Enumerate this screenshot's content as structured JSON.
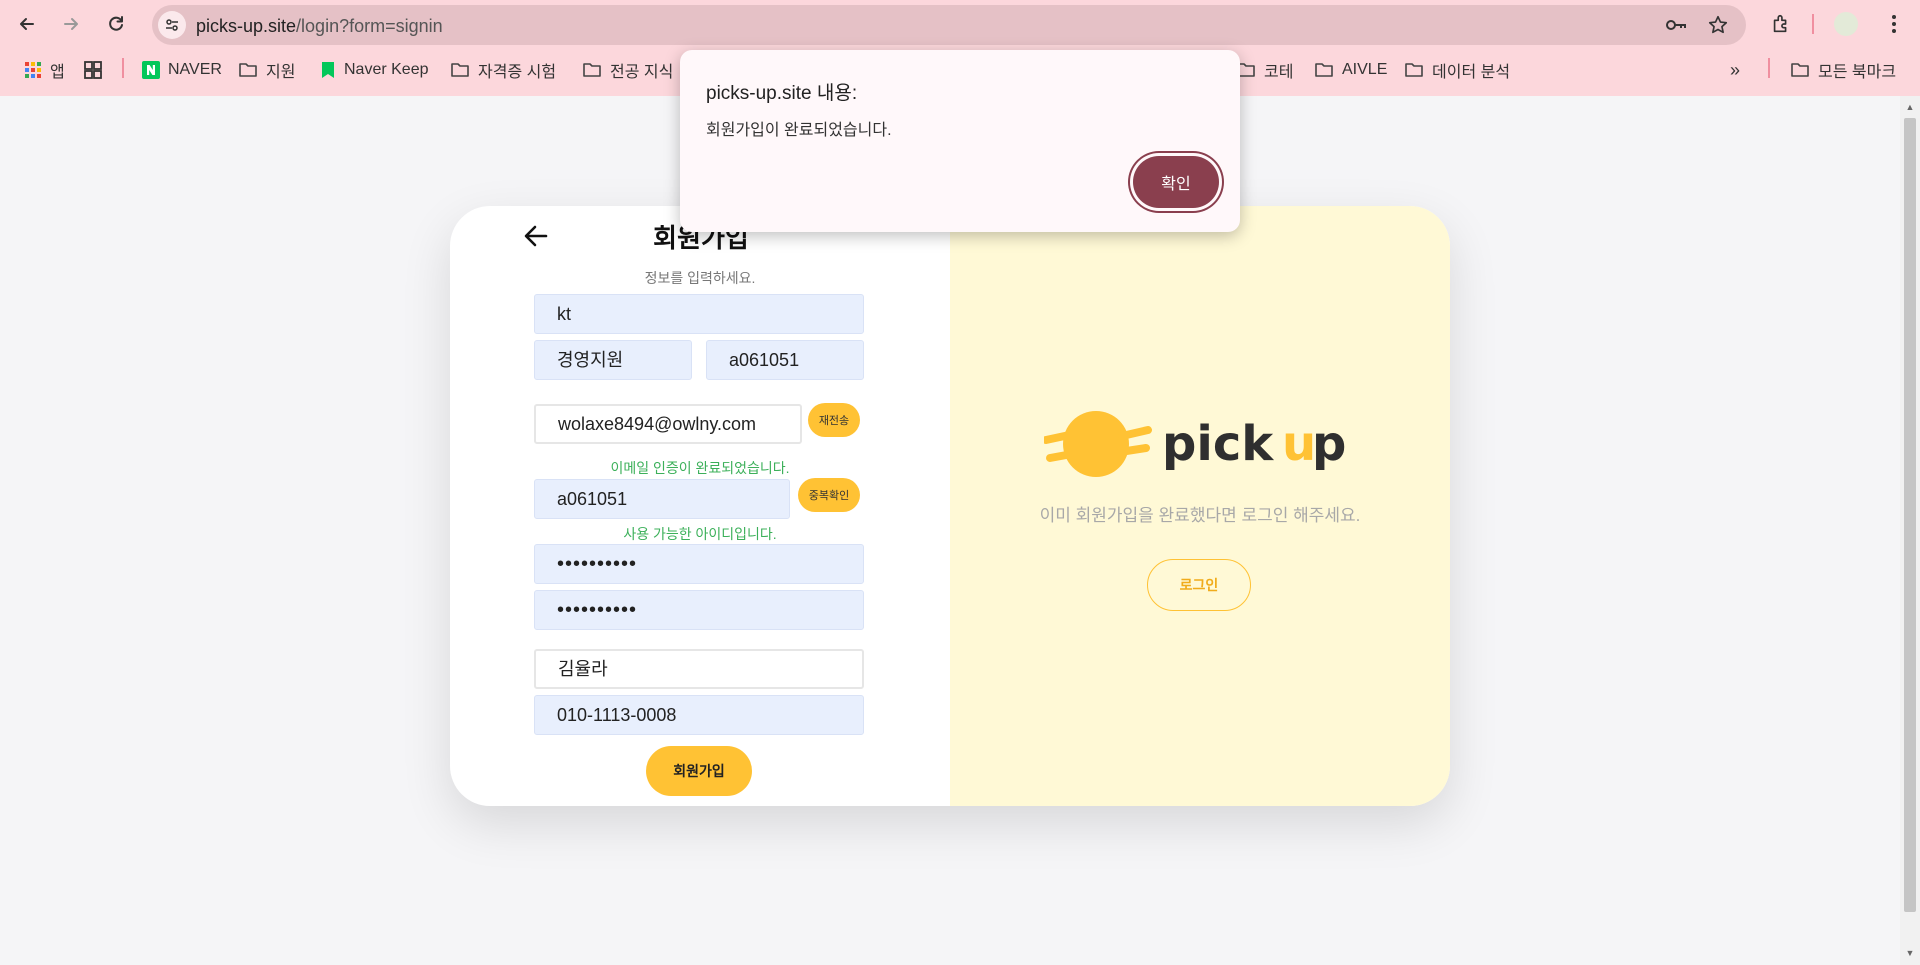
{
  "browser": {
    "url_host": "picks-up.site",
    "url_path": "/login?form=signin",
    "bookmarks": [
      {
        "label": "앱",
        "icon": "apps-grid-icon"
      },
      {
        "label": "",
        "icon": "tab-groups-icon"
      },
      {
        "label": "NAVER",
        "icon": "naver-icon"
      },
      {
        "label": "지원",
        "icon": "folder-icon"
      },
      {
        "label": "Naver Keep",
        "icon": "keep-bookmark-icon"
      },
      {
        "label": "자격증 시험",
        "icon": "folder-icon"
      },
      {
        "label": "전공 지식",
        "icon": "folder-icon"
      },
      {
        "label": "코테",
        "icon": "folder-icon"
      },
      {
        "label": "AIVLE",
        "icon": "folder-icon"
      },
      {
        "label": "데이터 분석",
        "icon": "folder-icon"
      },
      {
        "label": "모든 북마크",
        "icon": "folder-icon"
      }
    ],
    "overflow_label": "»"
  },
  "signup": {
    "title": "회원가입",
    "subtitle": "정보를 입력하세요.",
    "company": "kt",
    "department": "경영지원",
    "employee_id": "a061051",
    "email": "wolaxe8494@owlny.com",
    "resend_label": "재전송",
    "email_verified_msg": "이메일 인증이 완료되었습니다.",
    "user_id": "a061051",
    "dup_check_label": "중복확인",
    "id_available_msg": "사용 가능한 아이디입니다.",
    "password": "••••••••••",
    "password_confirm": "••••••••••",
    "name": "김율라",
    "phone": "010-1113-0008",
    "submit_label": "회원가입"
  },
  "promo": {
    "brand_word1": "pick",
    "brand_word2_u": "u",
    "brand_word2_p": "p",
    "hint": "이미 회원가입을 완료했다면 로그인 해주세요.",
    "login_label": "로그인",
    "accent_color": "#ffc234",
    "panel_color": "#fff9d6"
  },
  "alert": {
    "title": "picks-up.site 내용:",
    "message": "회원가입이 완료되었습니다.",
    "ok_label": "확인",
    "button_color": "#8a3f4e"
  }
}
